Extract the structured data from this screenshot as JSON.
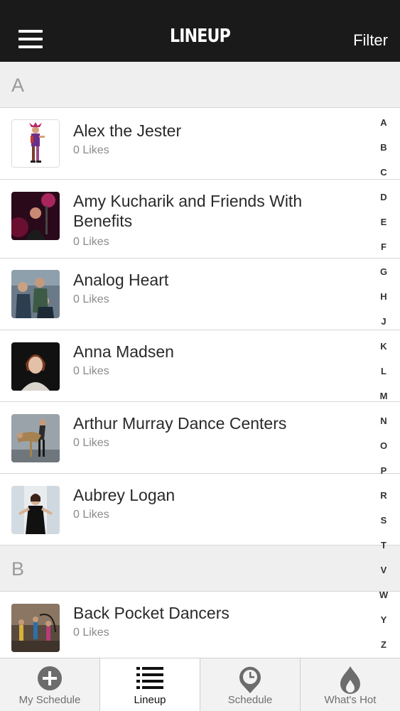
{
  "header": {
    "title": "LINEUP",
    "filter_label": "Filter"
  },
  "sections": [
    {
      "letter": "A",
      "rows": [
        {
          "name": "Alex the Jester",
          "likes": "0 Likes"
        },
        {
          "name": "Amy Kucharik and Friends With Benefits",
          "likes": "0 Likes"
        },
        {
          "name": "Analog Heart",
          "likes": "0 Likes"
        },
        {
          "name": "Anna Madsen",
          "likes": "0 Likes"
        },
        {
          "name": "Arthur Murray Dance Centers",
          "likes": "0 Likes"
        },
        {
          "name": "Aubrey Logan",
          "likes": "0 Likes"
        }
      ]
    },
    {
      "letter": "B",
      "rows": [
        {
          "name": "Back Pocket Dancers",
          "likes": "0 Likes"
        }
      ]
    }
  ],
  "alphabet_index": [
    "A",
    "B",
    "C",
    "D",
    "E",
    "F",
    "G",
    "H",
    "J",
    "K",
    "L",
    "M",
    "N",
    "O",
    "P",
    "R",
    "S",
    "T",
    "V",
    "W",
    "Y",
    "Z"
  ],
  "tabs": [
    {
      "label": "My Schedule",
      "icon": "plus-circle-icon"
    },
    {
      "label": "Lineup",
      "icon": "list-icon",
      "active": true
    },
    {
      "label": "Schedule",
      "icon": "clock-pin-icon"
    },
    {
      "label": "What's Hot",
      "icon": "flame-icon"
    }
  ],
  "colors": {
    "header_bg": "#1b1a1a",
    "section_bg": "#efefef",
    "tabbar_bg": "#f2f2f2"
  }
}
